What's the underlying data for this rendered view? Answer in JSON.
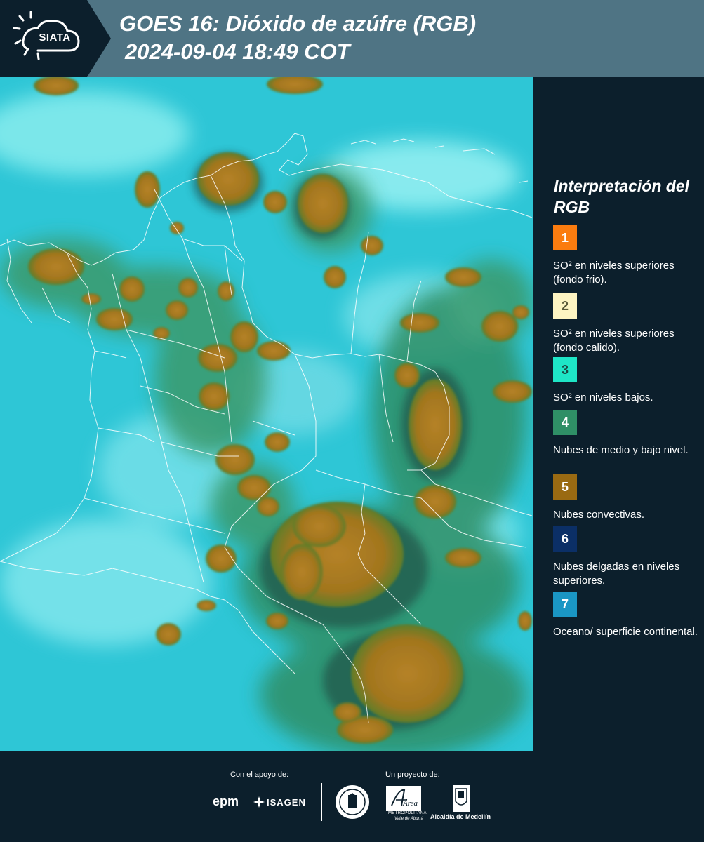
{
  "header": {
    "logo_text": "SIATA",
    "title": "GOES 16: Dióxido de azúfre (RGB)",
    "datetime": "2024-09-04 18:49 COT"
  },
  "map": {
    "description_icon": "satellite-rgb-map"
  },
  "legend": {
    "title": "Interpretación del RGB",
    "items": [
      {
        "number": "1",
        "color": "#fb7c0f",
        "num_color": "#ffffff",
        "text": "SO² en niveles superiores (fondo frio)."
      },
      {
        "number": "2",
        "color": "#fdf4c2",
        "num_color": "#5a5a3a",
        "text": "SO² en niveles superiores (fondo calido)."
      },
      {
        "number": "3",
        "color": "#1ee6c7",
        "num_color": "#1a4a44",
        "text": "SO² en niveles bajos."
      },
      {
        "number": "4",
        "color": "#2f8f66",
        "num_color": "#ffffff",
        "text": "Nubes de medio y bajo nivel."
      },
      {
        "number": "5",
        "color": "#9a6a12",
        "num_color": "#ffffff",
        "text": "Nubes convectivas."
      },
      {
        "number": "6",
        "color": "#0b2f66",
        "num_color": "#ffffff",
        "text": "Nubes delgadas en niveles superiores."
      },
      {
        "number": "7",
        "color": "#1a96c4",
        "num_color": "#ffffff",
        "text": "Oceano/ superficie continental."
      }
    ]
  },
  "footer": {
    "support_label": "Con el apoyo de:",
    "project_label": "Un proyecto de:",
    "epm_text": "epm",
    "isagen_text": "ISAGEN",
    "area_text": "Área",
    "area_sub1": "METROPOLITANA",
    "area_sub2": "Valle de Aburrá",
    "alcaldia_text": "Alcaldía de Medellín"
  }
}
